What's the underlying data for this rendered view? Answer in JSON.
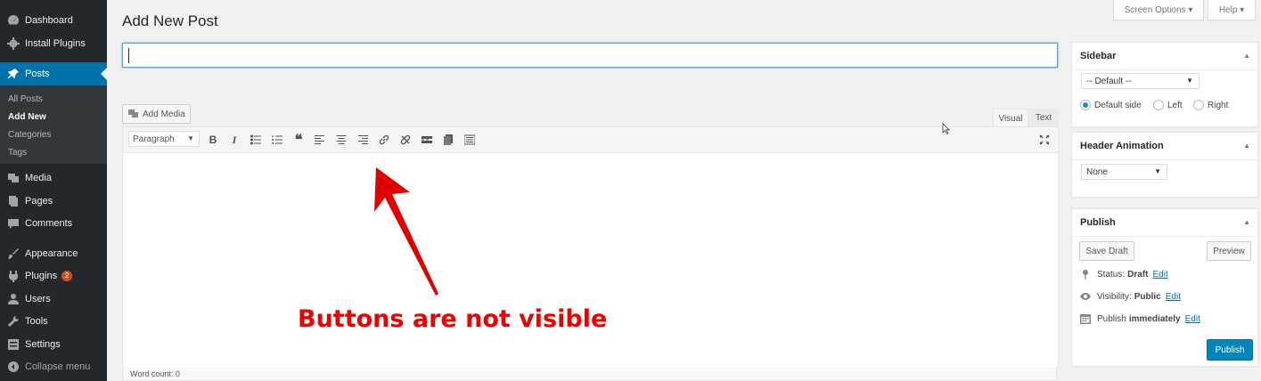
{
  "sidebar": {
    "items": [
      {
        "label": "Dashboard",
        "icon": "dashboard-icon"
      },
      {
        "label": "Install Plugins",
        "icon": "gear-icon"
      },
      {
        "label": "Posts",
        "icon": "pin-icon"
      },
      {
        "label": "Media",
        "icon": "media-icon"
      },
      {
        "label": "Pages",
        "icon": "pages-icon"
      },
      {
        "label": "Comments",
        "icon": "comment-icon"
      },
      {
        "label": "Appearance",
        "icon": "brush-icon"
      },
      {
        "label": "Plugins",
        "icon": "plugin-icon",
        "badge": "2"
      },
      {
        "label": "Users",
        "icon": "user-icon"
      },
      {
        "label": "Tools",
        "icon": "wrench-icon"
      },
      {
        "label": "Settings",
        "icon": "settings-icon"
      },
      {
        "label": "Collapse menu",
        "icon": "collapse-icon"
      }
    ],
    "posts_sub": [
      "All Posts",
      "Add New",
      "Categories",
      "Tags"
    ]
  },
  "top": {
    "screen_options": "Screen Options ▾",
    "help": "Help ▾"
  },
  "page_title": "Add New Post",
  "title_input": {
    "value": ""
  },
  "editor": {
    "add_media": "Add Media",
    "tab_visual": "Visual",
    "tab_text": "Text",
    "format": "Paragraph",
    "word_count": "Word count: 0"
  },
  "annotation": "Buttons are not visible",
  "sidebar_box": {
    "title": "Sidebar",
    "select": "-- Default --",
    "options": [
      "Default side",
      "Left",
      "Right"
    ],
    "selected_option": "Default side"
  },
  "header_animation": {
    "title": "Header Animation",
    "select": "None"
  },
  "publish": {
    "title": "Publish",
    "save_draft": "Save Draft",
    "preview": "Preview",
    "status_label": "Status:",
    "status_value": "Draft",
    "visibility_label": "Visibility:",
    "visibility_value": "Public",
    "publish_label": "Publish",
    "publish_value": "immediately",
    "edit": "Edit",
    "publish_button": "Publish"
  },
  "colors": {
    "accent": "#0073aa",
    "sidebar_bg": "#23282d",
    "annotation": "#e00000",
    "badge": "#d54e21"
  }
}
